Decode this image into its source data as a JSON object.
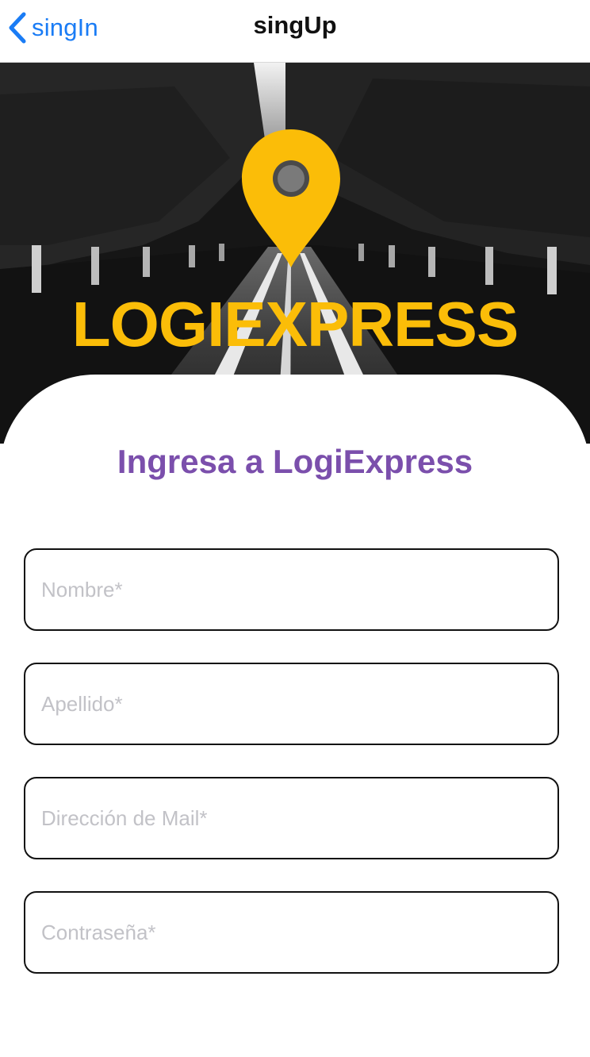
{
  "navbar": {
    "back_label": "singIn",
    "title": "singUp"
  },
  "hero": {
    "brand": "LOGIEXPRESS",
    "pin_icon": "map-pin-icon"
  },
  "form": {
    "heading": "Ingresa a LogiExpress",
    "fields": [
      {
        "placeholder": "Nombre*",
        "value": ""
      },
      {
        "placeholder": "Apellido*",
        "value": ""
      },
      {
        "placeholder": "Dirección de Mail*",
        "value": ""
      },
      {
        "placeholder": "Contraseña*",
        "value": ""
      }
    ]
  },
  "colors": {
    "accent": "#1a7cf5",
    "brand": "#fbbd08",
    "heading": "#7b4fac"
  }
}
